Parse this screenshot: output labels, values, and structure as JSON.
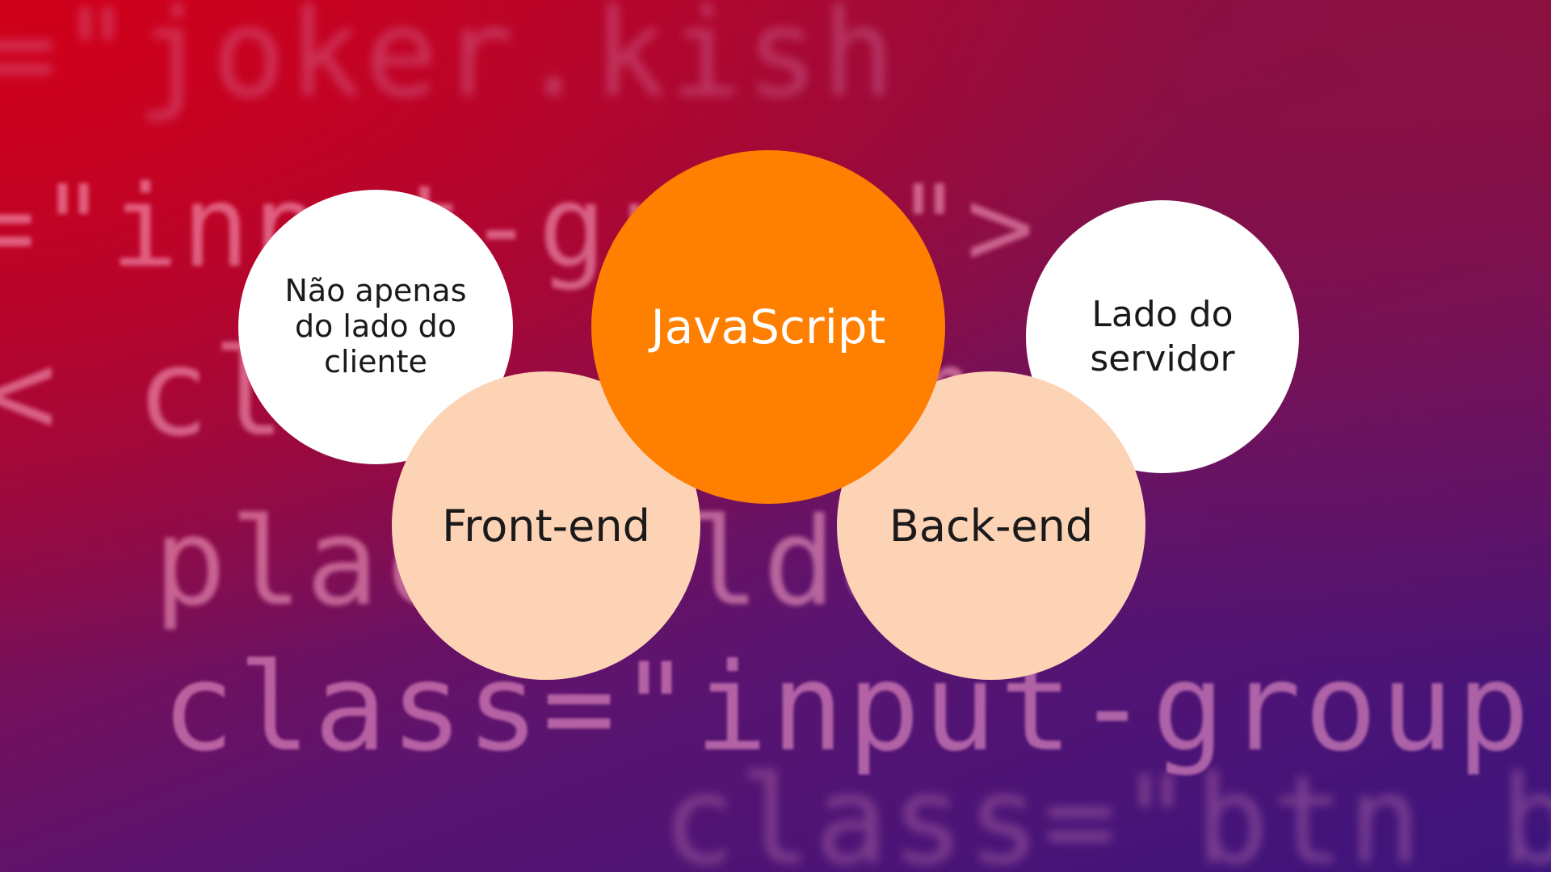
{
  "background": {
    "code_lines": [
      "=\"joker.kish",
      "=\"input-group\">",
      "< class=\"form",
      "placeholder",
      "class=\"input-group-b",
      "class=\"btn btn"
    ]
  },
  "diagram": {
    "center": {
      "label": "JavaScript",
      "color": "#ff7f00"
    },
    "left_top": {
      "label": "Não apenas do lado do cliente",
      "color": "#ffffff"
    },
    "left_bottom": {
      "label": "Front-end",
      "color": "#fdd3b6"
    },
    "right_top": {
      "label": "Lado do servidor",
      "color": "#ffffff"
    },
    "right_bottom": {
      "label": "Back-end",
      "color": "#fdd3b6"
    }
  }
}
